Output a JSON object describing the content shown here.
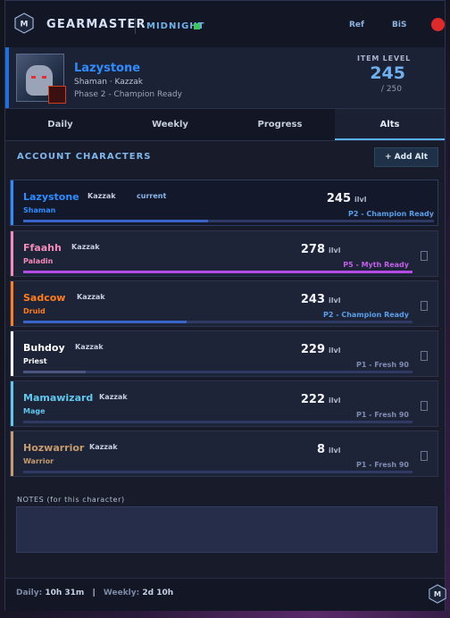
{
  "topbar": {
    "brand": "GEARMASTER",
    "season": "MIDNIGHT",
    "season_status_color": "#3cc75a",
    "links": [
      "Ref",
      "BiS"
    ],
    "close_color": "#e02a2a"
  },
  "header": {
    "name": "Lazystone",
    "subtitle": "Shaman  ·  Kazzak",
    "phase": "Phase 2  -  Champion Ready",
    "item_level_label": "ITEM LEVEL",
    "item_level": "245",
    "item_level_max": "/ 250",
    "accent_color": "#1e6fe0"
  },
  "tabs": [
    {
      "label": "Daily",
      "active": false
    },
    {
      "label": "Weekly",
      "active": false
    },
    {
      "label": "Progress",
      "active": false
    },
    {
      "label": "Alts",
      "active": true
    }
  ],
  "alts": {
    "title": "ACCOUNT CHARACTERS",
    "add_label": "+ Add Alt",
    "characters": [
      {
        "name": "Lazystone",
        "realm": "Kazzak",
        "tag": "current",
        "class": "Shaman",
        "ilvl": "245",
        "ilvl_unit": "ilvl",
        "phase": "P2 - Champion Ready",
        "color": "#2e8cff",
        "phase_color": "#5a9fe8",
        "bar_fill": 0.45,
        "bar_color": "#3b64c8"
      },
      {
        "name": "Ffaahh",
        "realm": "Kazzak",
        "tag": "",
        "class": "Paladin",
        "ilvl": "278",
        "ilvl_unit": "ilvl",
        "phase": "P5 - Myth Ready",
        "color": "#f48cba",
        "phase_color": "#c060e8",
        "bar_fill": 1.0,
        "bar_color": "#b54be6"
      },
      {
        "name": "Sadcow",
        "realm": "Kazzak",
        "tag": "",
        "class": "Druid",
        "ilvl": "243",
        "ilvl_unit": "ilvl",
        "phase": "P2 - Champion Ready",
        "color": "#ff7d1a",
        "phase_color": "#5a9fe8",
        "bar_fill": 0.42,
        "bar_color": "#3b64c8"
      },
      {
        "name": "Buhdoy",
        "realm": "Kazzak",
        "tag": "",
        "class": "Priest",
        "ilvl": "229",
        "ilvl_unit": "ilvl",
        "phase": "P1 - Fresh 90",
        "color": "#ffffff",
        "phase_color": "#7f8cb0",
        "bar_fill": 0.16,
        "bar_color": "#4b5680"
      },
      {
        "name": "Mamawizard",
        "realm": "Kazzak",
        "tag": "",
        "class": "Mage",
        "ilvl": "222",
        "ilvl_unit": "ilvl",
        "phase": "P1 - Fresh 90",
        "color": "#5ec8ee",
        "phase_color": "#7f8cb0",
        "bar_fill": 0.0,
        "bar_color": "#4b5680"
      },
      {
        "name": "Hozwarrior",
        "realm": "Kazzak",
        "tag": "",
        "class": "Warrior",
        "ilvl": "8",
        "ilvl_unit": "ilvl",
        "phase": "P1 - Fresh 90",
        "color": "#c69b6d",
        "phase_color": "#7f8cb0",
        "bar_fill": 0.0,
        "bar_color": "#4b5680"
      }
    ]
  },
  "notes": {
    "label": "NOTES  (for this character)",
    "value": ""
  },
  "footer": {
    "daily_label": "Daily:",
    "daily_value": "10h 31m",
    "sep": "|",
    "weekly_label": "Weekly:",
    "weekly_value": "2d 10h"
  }
}
